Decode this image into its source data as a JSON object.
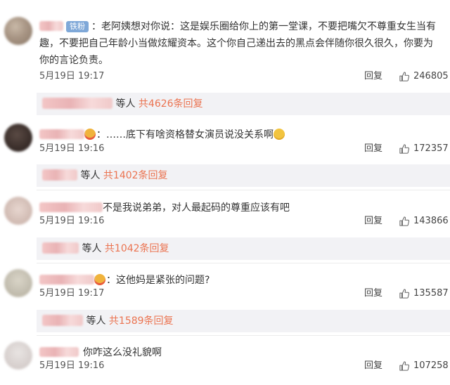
{
  "comments": [
    {
      "badge": "铁粉",
      "text": "：老阿姨想对你说：这是娱乐圈给你上的第一堂课，不要把嘴欠不尊重女生当有趣，不要把自己年龄小当做炫耀资本。这个你自己递出去的黑点会伴随你很久很久，你要为你的言论负责。",
      "time": "5月19日 19:17",
      "reply_label": "回复",
      "likes": "246805",
      "sub_label": "等人",
      "sub_link": "共4626条回复"
    },
    {
      "text": "：……底下有啥资格替女演员说没关系啊",
      "time": "5月19日 19:16",
      "reply_label": "回复",
      "likes": "172357",
      "sub_label": "等人",
      "sub_link": "共1402条回复"
    },
    {
      "text": "不是我说弟弟，对人最起码的尊重应该有吧",
      "time": "5月19日 19:16",
      "reply_label": "回复",
      "likes": "143866",
      "sub_label": "等人",
      "sub_link": "共1042条回复"
    },
    {
      "text": "：这他妈是紧张的问题?",
      "time": "5月19日 19:17",
      "reply_label": "回复",
      "likes": "135587",
      "sub_label": "等人",
      "sub_link": "共1589条回复"
    },
    {
      "text": "你咋这么没礼貌啊",
      "time": "5月19日 19:16",
      "reply_label": "回复",
      "likes": "107258"
    }
  ],
  "icons": {
    "like": "thumbs-up-icon"
  },
  "colors": {
    "link": "#eb7350",
    "badge": "#7fa8d8",
    "sub_bg": "#f2f2f5"
  }
}
